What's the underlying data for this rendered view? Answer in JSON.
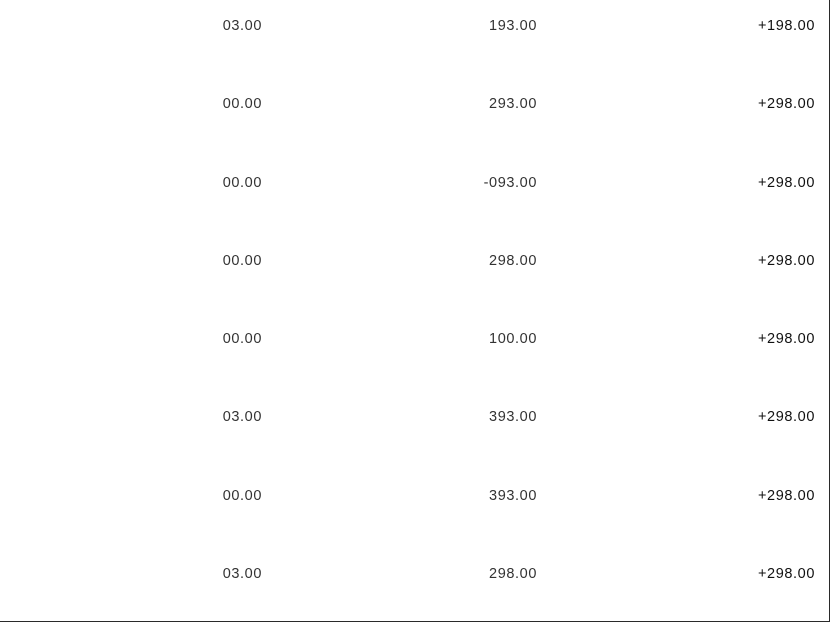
{
  "table": {
    "rows": [
      {
        "col1": "03.00",
        "col2": "193.00",
        "col3": "+198.00"
      },
      {
        "col1": "00.00",
        "col2": "293.00",
        "col3": "+298.00"
      },
      {
        "col1": "00.00",
        "col2": "-093.00",
        "col3": "+298.00"
      },
      {
        "col1": "00.00",
        "col2": "298.00",
        "col3": "+298.00"
      },
      {
        "col1": "00.00",
        "col2": "100.00",
        "col3": "+298.00"
      },
      {
        "col1": "03.00",
        "col2": "393.00",
        "col3": "+298.00"
      },
      {
        "col1": "00.00",
        "col2": "393.00",
        "col3": "+298.00"
      },
      {
        "col1": "03.00",
        "col2": "298.00",
        "col3": "+298.00"
      }
    ]
  }
}
